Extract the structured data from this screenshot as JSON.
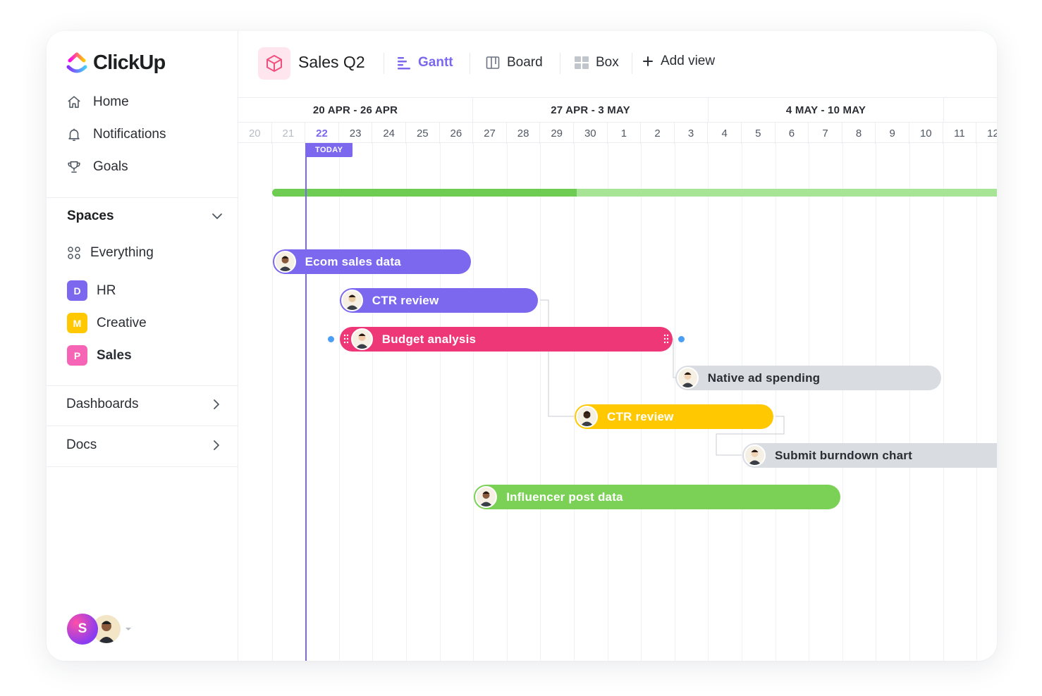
{
  "app": {
    "brand": "ClickUp",
    "brand_colors": [
      "#8930fd",
      "#ff02f0",
      "#ffc800",
      "#49ccf9"
    ]
  },
  "sidebar": {
    "nav": [
      {
        "label": "Home",
        "icon": "home-icon"
      },
      {
        "label": "Notifications",
        "icon": "bell-icon"
      },
      {
        "label": "Goals",
        "icon": "trophy-icon"
      }
    ],
    "spaces_label": "Spaces",
    "everything_label": "Everything",
    "spaces": [
      {
        "letter": "D",
        "label": "HR",
        "color": "#7b68ee"
      },
      {
        "letter": "M",
        "label": "Creative",
        "color": "#ffc800"
      },
      {
        "letter": "P",
        "label": "Sales",
        "color": "#f665b5"
      }
    ],
    "sections": [
      {
        "label": "Dashboards"
      },
      {
        "label": "Docs"
      }
    ],
    "user_initial": "S"
  },
  "topbar": {
    "project": "Sales Q2",
    "views": [
      {
        "label": "Gantt",
        "icon": "gantt-icon",
        "active": true
      },
      {
        "label": "Board",
        "icon": "board-icon",
        "active": false
      },
      {
        "label": "Box",
        "icon": "box-icon",
        "active": false
      }
    ],
    "add_view": "Add view"
  },
  "gantt": {
    "weeks": [
      "20 APR - 26 APR",
      "27 APR - 3 MAY",
      "4 MAY - 10 MAY"
    ],
    "days": [
      "20",
      "21",
      "22",
      "23",
      "24",
      "25",
      "26",
      "27",
      "28",
      "29",
      "30",
      "1",
      "2",
      "3",
      "4",
      "5",
      "6",
      "7",
      "8",
      "9",
      "10",
      "11",
      "12"
    ],
    "today_label": "TODAY",
    "today_day": "22",
    "overall_progress": 0.42,
    "colors": {
      "accent": "#7b68ee",
      "pink": "#ee3776",
      "yellow": "#ffc800",
      "green": "#7bd155",
      "gray": "#d9dce1"
    },
    "tasks": [
      {
        "name": "Ecom sales data",
        "color": "#7b68ee",
        "start": "21",
        "end": "26"
      },
      {
        "name": "CTR review",
        "color": "#7b68ee",
        "start": "23",
        "end": "28"
      },
      {
        "name": "Budget analysis",
        "color": "#ee3776",
        "start": "23",
        "end": "2"
      },
      {
        "name": "Native ad spending",
        "color": "#d9dce1",
        "start": "3",
        "end": "10"
      },
      {
        "name": "CTR review",
        "color": "#ffc800",
        "start": "30",
        "end": "5"
      },
      {
        "name": "Submit burndown chart",
        "color": "#d9dce1",
        "start": "5",
        "end": "12"
      },
      {
        "name": "Influencer post data",
        "color": "#7bd155",
        "start": "27",
        "end": "7"
      }
    ]
  }
}
